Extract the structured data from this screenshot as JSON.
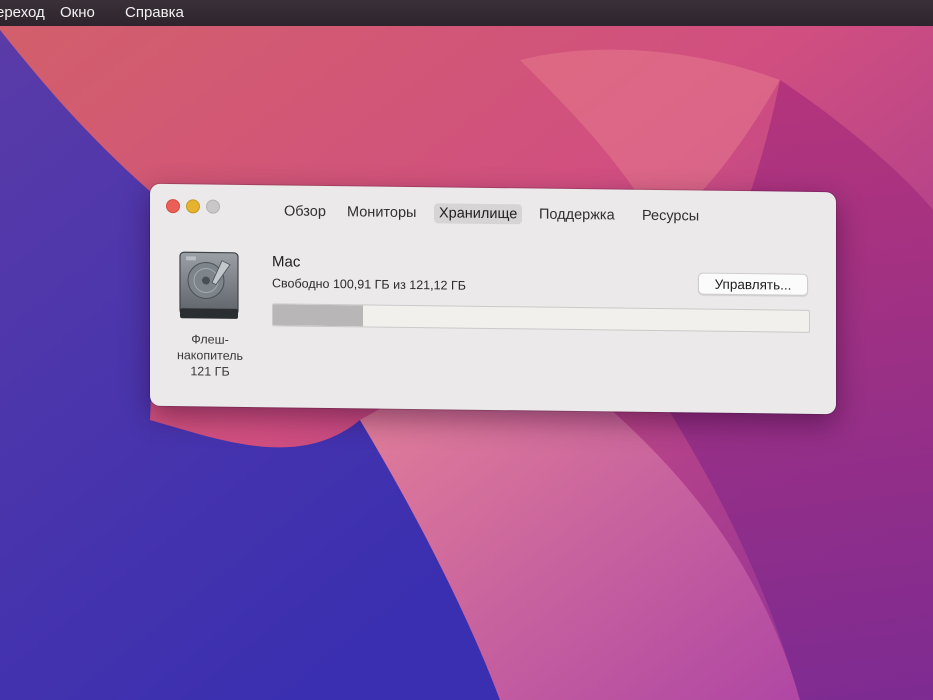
{
  "menubar": {
    "items": [
      "ереход",
      "Окно",
      "Справка"
    ]
  },
  "window": {
    "tabs": [
      "Обзор",
      "Мониторы",
      "Хранилище",
      "Поддержка",
      "Ресурсы"
    ],
    "selected_tab": "Хранилище"
  },
  "disk": {
    "type_line1": "Флеш-",
    "type_line2": "накопитель",
    "size": "121 ГБ"
  },
  "volume": {
    "name": "Mac",
    "free_text": "Свободно 100,91 ГБ из 121,12 ГБ",
    "used_fraction": 0.167
  },
  "buttons": {
    "manage": "Управлять..."
  },
  "colors": {
    "close": "#ec5f57",
    "minimize": "#e6b32e",
    "zoom": "#c9c7c8",
    "used_segment": "#b8b6b7"
  }
}
